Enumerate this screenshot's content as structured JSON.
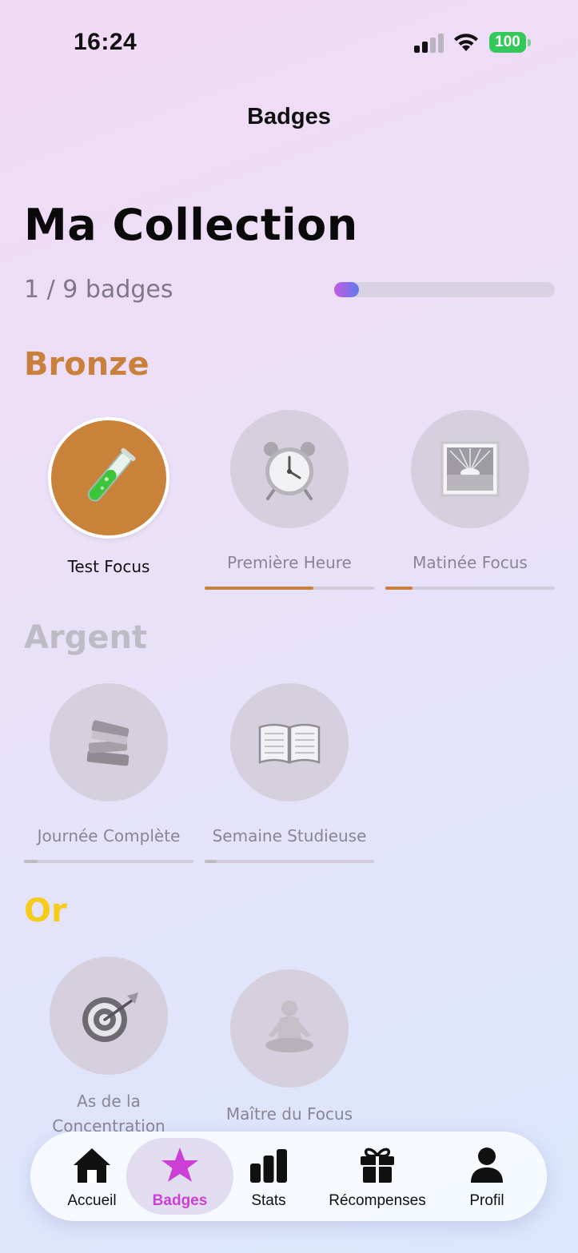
{
  "status_bar": {
    "time": "16:24",
    "battery": "100",
    "icons": [
      "signal-icon",
      "wifi-icon",
      "battery-icon"
    ]
  },
  "nav": {
    "title": "Badges"
  },
  "collection": {
    "title": "Ma Collection",
    "count_text": "1 / 9 badges",
    "progress": 0.111,
    "gradient": [
      "#c45be0",
      "#5f7af0"
    ]
  },
  "sections": {
    "bronze": {
      "title": "Bronze",
      "color": "#c8803a",
      "badges": [
        {
          "label": "Test Focus",
          "icon": "test-tube-icon",
          "unlocked": true,
          "progress": 1.0
        },
        {
          "label": "Première Heure",
          "icon": "alarm-clock-icon",
          "unlocked": false,
          "progress": 0.64
        },
        {
          "label": "Matinée Focus",
          "icon": "sunrise-icon",
          "unlocked": false,
          "progress": 0.16
        }
      ]
    },
    "argent": {
      "title": "Argent",
      "color": "#bdbcc4",
      "badges": [
        {
          "label": "Journée Complète",
          "icon": "books-icon",
          "unlocked": false,
          "progress": 0.08
        },
        {
          "label": "Semaine Studieuse",
          "icon": "open-book-icon",
          "unlocked": false,
          "progress": 0.07
        }
      ]
    },
    "or": {
      "title": "Or",
      "color": "#f6cc1b",
      "badges": [
        {
          "label": "As de la Concentration",
          "icon": "target-icon",
          "unlocked": false
        },
        {
          "label": "Maître du Focus",
          "icon": "meditation-icon",
          "unlocked": false
        }
      ]
    }
  },
  "tabbar": {
    "active": "badges",
    "active_color": "#cc3fd6",
    "items": [
      {
        "label": "Accueil",
        "icon": "home-icon"
      },
      {
        "label": "Badges",
        "icon": "star-icon"
      },
      {
        "label": "Stats",
        "icon": "bar-chart-icon"
      },
      {
        "label": "Récompenses",
        "icon": "gift-icon"
      },
      {
        "label": "Profil",
        "icon": "person-icon"
      }
    ]
  }
}
